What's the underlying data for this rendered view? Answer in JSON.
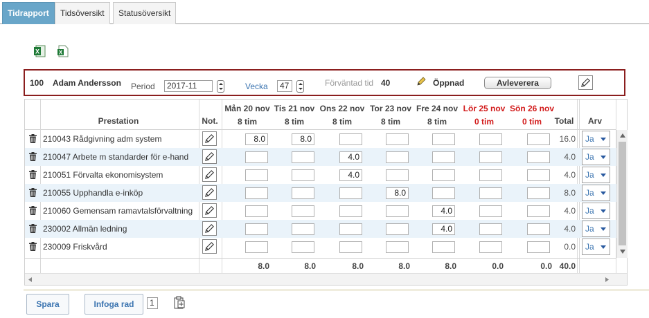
{
  "tabs": [
    {
      "label": "Tidrapport",
      "active": true
    },
    {
      "label": "Tidsöversikt",
      "active": false
    },
    {
      "label": "Statusöversikt",
      "active": false
    }
  ],
  "export": {
    "excel_icon": "excel-icon",
    "export_icon": "excel-export-icon"
  },
  "header": {
    "user_id": "100",
    "user_name": "Adam Andersson",
    "period_label": "Period",
    "period_value": "2017-11",
    "week_label": "Vecka",
    "week_value": "47",
    "expected_label": "Förväntad tid",
    "expected_value": "40",
    "status": "Öppnad",
    "submit_label": "Avleverera"
  },
  "grid": {
    "columns": {
      "prestation": "Prestation",
      "note": "Not.",
      "total": "Total",
      "arv": "Arv"
    },
    "days": [
      {
        "day": "Mån 20 nov",
        "hours": "8 tim",
        "weekend": false
      },
      {
        "day": "Tis 21 nov",
        "hours": "8 tim",
        "weekend": false
      },
      {
        "day": "Ons 22 nov",
        "hours": "8 tim",
        "weekend": false
      },
      {
        "day": "Tor 23 nov",
        "hours": "8 tim",
        "weekend": false
      },
      {
        "day": "Fre 24 nov",
        "hours": "8 tim",
        "weekend": false
      },
      {
        "day": "Lör 25 nov",
        "hours": "0 tim",
        "weekend": true
      },
      {
        "day": "Sön 26 nov",
        "hours": "0 tim",
        "weekend": true
      }
    ],
    "rows": [
      {
        "prestation": "210043 Rådgivning adm system",
        "values": [
          "8.0",
          "8.0",
          "",
          "",
          "",
          "",
          ""
        ],
        "total": "16.0",
        "arv": "Ja"
      },
      {
        "prestation": "210047 Arbete m standarder för e-hand",
        "values": [
          "",
          "",
          "4.0",
          "",
          "",
          "",
          ""
        ],
        "total": "4.0",
        "arv": "Ja"
      },
      {
        "prestation": "210051 Förvalta ekonomisystem",
        "values": [
          "",
          "",
          "4.0",
          "",
          "",
          "",
          ""
        ],
        "total": "4.0",
        "arv": "Ja"
      },
      {
        "prestation": "210055 Upphandla e-inköp",
        "values": [
          "",
          "",
          "",
          "8.0",
          "",
          "",
          ""
        ],
        "total": "8.0",
        "arv": "Ja"
      },
      {
        "prestation": "210060 Gemensam ramavtalsförvaltning",
        "values": [
          "",
          "",
          "",
          "",
          "4.0",
          "",
          ""
        ],
        "total": "4.0",
        "arv": "Ja"
      },
      {
        "prestation": "230002 Allmän ledning",
        "values": [
          "",
          "",
          "",
          "",
          "4.0",
          "",
          ""
        ],
        "total": "4.0",
        "arv": "Ja"
      },
      {
        "prestation": "230009 Friskvård",
        "values": [
          "",
          "",
          "",
          "",
          "",
          "",
          ""
        ],
        "total": "0.0",
        "arv": "Ja"
      }
    ],
    "sums": [
      "8.0",
      "8.0",
      "8.0",
      "8.0",
      "8.0",
      "0.0",
      "0.0"
    ],
    "sum_total": "40.0"
  },
  "footer": {
    "save_label": "Spara",
    "insert_label": "Infoga rad",
    "insert_count": "1"
  }
}
